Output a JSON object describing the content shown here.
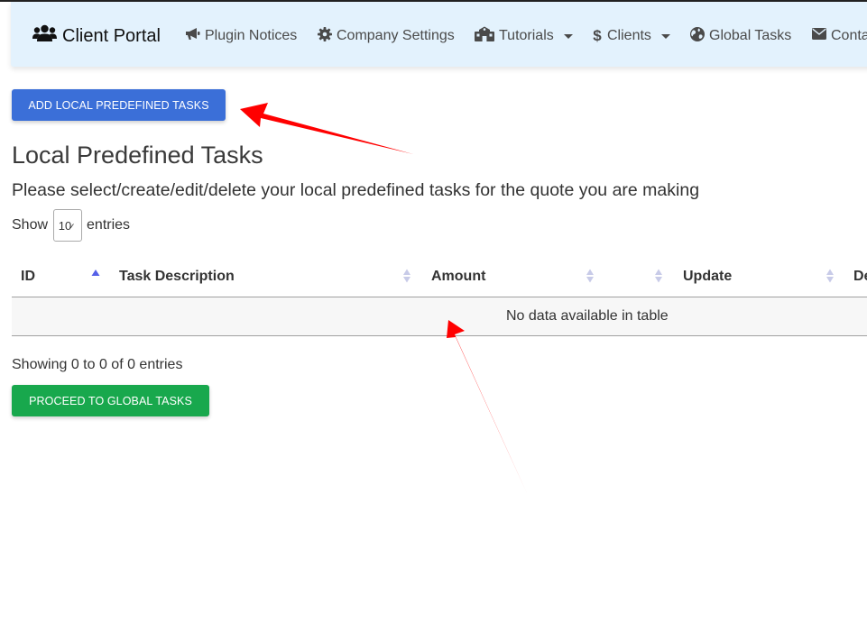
{
  "nav": {
    "brand": "Client Portal",
    "items": [
      {
        "label": "Plugin Notices",
        "icon": "megaphone-icon"
      },
      {
        "label": "Company Settings",
        "icon": "gear-icon"
      },
      {
        "label": "Tutorials",
        "icon": "school-icon",
        "dropdown": true
      },
      {
        "label": "Clients",
        "icon": "dollar-icon",
        "dropdown": true
      },
      {
        "label": "Global Tasks",
        "icon": "globe-icon"
      },
      {
        "label": "Conta",
        "icon": "envelope-icon"
      }
    ]
  },
  "buttons": {
    "add_label": "ADD LOCAL PREDEFINED TASKS",
    "proceed_label": "PROCEED TO GLOBAL TASKS"
  },
  "page": {
    "title": "Local Predefined Tasks",
    "subtitle": "Please select/create/edit/delete your local predefined tasks for the quote you are making"
  },
  "length_menu": {
    "prefix": "Show",
    "value": "10",
    "suffix": "entries"
  },
  "table": {
    "columns": [
      "ID",
      "Task Description",
      "Amount",
      "",
      "Update",
      "De"
    ],
    "sorted_column": "ID",
    "sort_direction": "ascending",
    "empty_message": "No data available in table"
  },
  "info": "Showing 0 to 0 of 0 entries",
  "colors": {
    "navbar_bg": "#e3f2fd",
    "add_button": "#3b6fd8",
    "proceed_button": "#18a84d",
    "annotation_arrow": "#ff0000",
    "sort_active": "#5560e8",
    "sort_inactive": "#c8cbe8"
  }
}
